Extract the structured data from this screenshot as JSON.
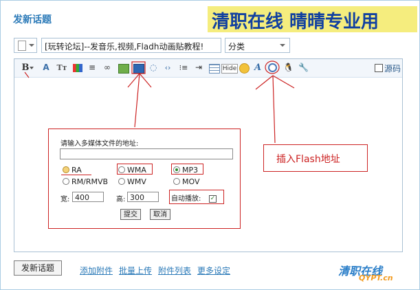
{
  "header": {
    "title": "发新话题",
    "banner": "清职在线 晴晴专业用"
  },
  "form": {
    "subject_value": "[玩转论坛]--发音乐,视频,Fladh动画贴教程!",
    "category_value": "分类"
  },
  "toolbar": {
    "hide_label": "Hide",
    "source_label": "源码",
    "icons": [
      "bold-icon",
      "font-color-icon",
      "font-size-icon",
      "color-icon",
      "align-icon",
      "link-icon",
      "image-icon",
      "media-icon",
      "quote-icon",
      "code-icon",
      "ordered-list-icon",
      "indent-icon",
      "table-icon",
      "hide-icon",
      "smiley-icon",
      "font-icon",
      "flash-icon",
      "qq-icon",
      "tool-icon"
    ]
  },
  "media_dialog": {
    "prompt": "请输入多媒体文件的地址:",
    "options": [
      "RA",
      "WMA",
      "MP3",
      "RM/RMVB",
      "WMV",
      "MOV"
    ],
    "selected": "MP3",
    "width_label": "宽:",
    "width_value": "400",
    "height_label": "高:",
    "height_value": "300",
    "autoplay_label": "自动播放:",
    "autoplay_checked": true,
    "submit_label": "提交",
    "cancel_label": "取消"
  },
  "annotation": {
    "note": "插入Flash地址"
  },
  "footer": {
    "submit_label": "发新话题",
    "links": [
      "添加附件",
      "批量上传",
      "附件列表",
      "更多设定"
    ],
    "logo": "清职在线",
    "logo_domain": "QYPT.cn"
  },
  "colors": {
    "accent": "#2b7ab8",
    "annotation_red": "#cc2222",
    "banner_bg": "#f5ed7e",
    "banner_text": "#1140a0"
  }
}
